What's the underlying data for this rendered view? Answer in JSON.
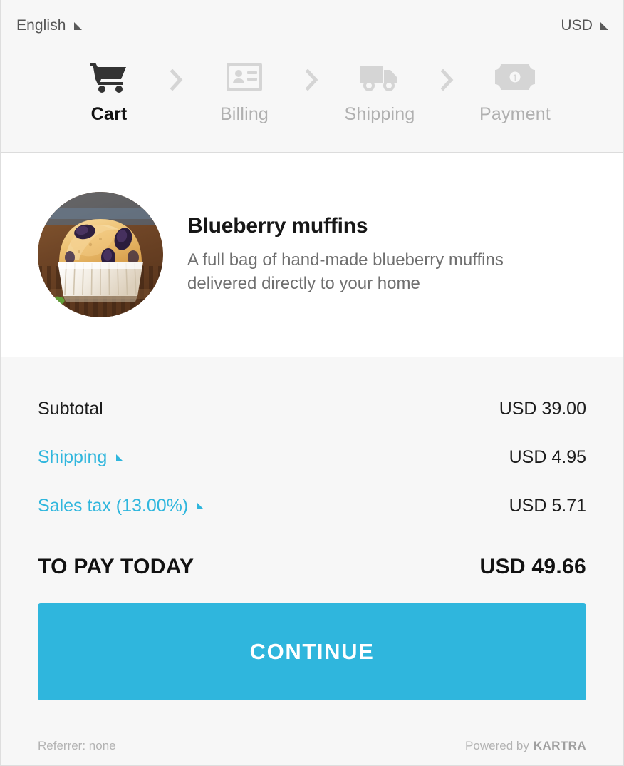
{
  "topbar": {
    "language": {
      "label": "English",
      "icon": "chevron-down-icon"
    },
    "currency": {
      "label": "USD",
      "icon": "chevron-down-icon"
    }
  },
  "steps": [
    {
      "label": "Cart",
      "icon": "shopping-cart-icon",
      "active": true
    },
    {
      "label": "Billing",
      "icon": "id-card-icon",
      "active": false
    },
    {
      "label": "Shipping",
      "icon": "delivery-truck-icon",
      "active": false
    },
    {
      "label": "Payment",
      "icon": "banknote-icon",
      "active": false
    }
  ],
  "step_separator_icon": "chevron-right-icon",
  "product": {
    "image_alt": "blueberry-muffin-photo",
    "title": "Blueberry muffins",
    "description": "A full bag of hand-made blueberry muffins delivered directly to your home"
  },
  "summary": {
    "rows": [
      {
        "label": "Subtotal",
        "value": "USD 39.00",
        "is_link": false
      },
      {
        "label": "Shipping",
        "value": "USD 4.95",
        "is_link": true
      },
      {
        "label": "Sales tax (13.00%)",
        "value": "USD 5.71",
        "is_link": true
      }
    ],
    "total_label": "TO PAY TODAY",
    "total_value": "USD 49.66"
  },
  "continue_button": {
    "label": "CONTINUE"
  },
  "footer": {
    "referrer": "Referrer: none",
    "powered_by": "Powered by",
    "brand": "KARTRA"
  },
  "colors": {
    "accent": "#2fb6dd",
    "header_bg": "#f7f7f7",
    "summary_bg": "#f7f7f7",
    "product_bg": "#ffffff",
    "active_step": "#111111",
    "inactive_step": "#b0b0b0"
  }
}
